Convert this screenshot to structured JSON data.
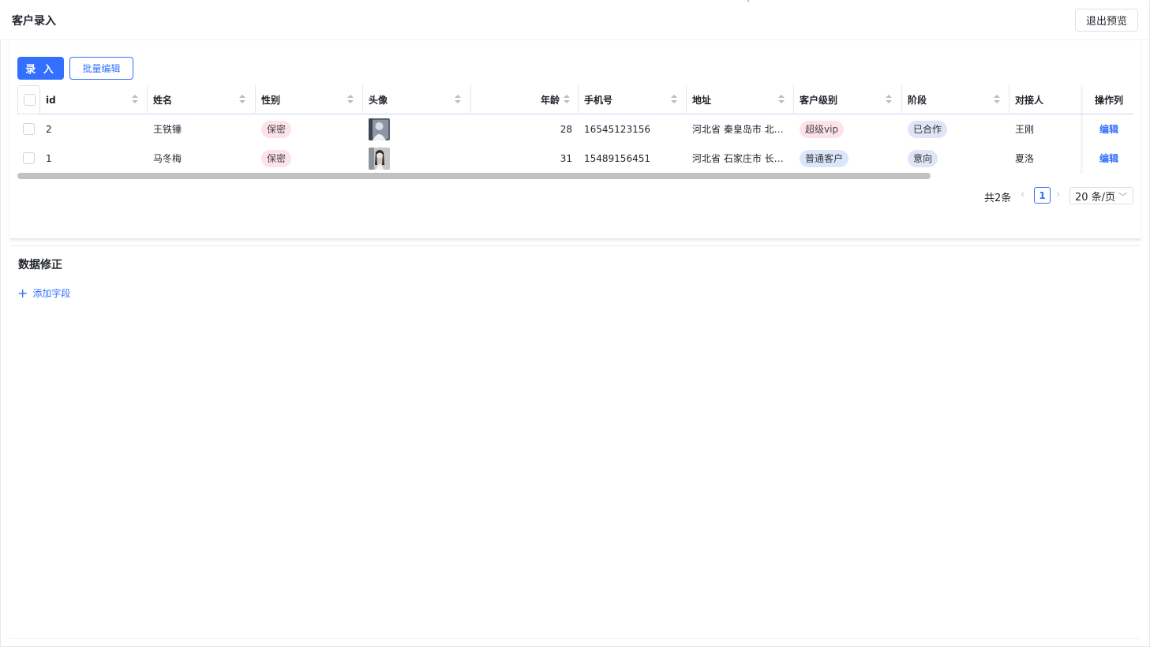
{
  "header": {
    "title": "客户录入",
    "exit_label": "退出预览"
  },
  "toolbar": {
    "add_label": "录 入",
    "batch_label": "批量编辑"
  },
  "table": {
    "columns": [
      "id",
      "姓名",
      "性别",
      "头像",
      "年龄",
      "手机号",
      "地址",
      "客户级别",
      "阶段",
      "对接人",
      "操作列"
    ],
    "rows": [
      {
        "id": "2",
        "name": "王铁锤",
        "gender": "保密",
        "avatar": "photo",
        "age": "28",
        "phone": "16545123156",
        "address": "河北省 秦皇岛市 北…",
        "level": "超级vip",
        "stage": "已合作",
        "contact": "王刚",
        "action": "编辑"
      },
      {
        "id": "1",
        "name": "马冬梅",
        "gender": "保密",
        "avatar": "photo",
        "age": "31",
        "phone": "15489156451",
        "address": "河北省 石家庄市 长…",
        "level": "普通客户",
        "stage": "意向",
        "contact": "夏洛",
        "action": "编辑"
      }
    ]
  },
  "pagination": {
    "total": "共2条",
    "current": "1",
    "page_size": "20 条/页"
  },
  "section": {
    "title": "数据修正",
    "add_field_label": "添加字段"
  },
  "icons": [
    "sort-icon",
    "chevron-left-icon",
    "chevron-right-icon",
    "chevron-down-icon",
    "plus-icon"
  ]
}
